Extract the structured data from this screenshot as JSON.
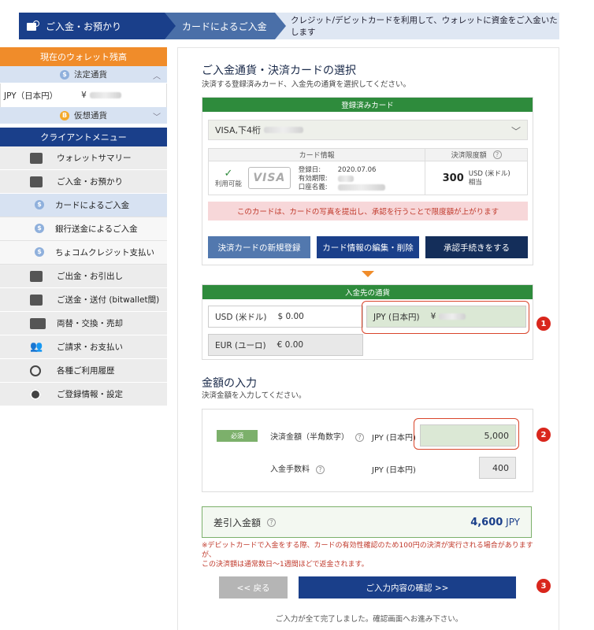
{
  "breadcrumb": {
    "step1": "ご入金・お預かり",
    "step2": "カードによるご入金",
    "description": "クレジット/デビットカードを利用して、ウォレットに資金をご入金いたします"
  },
  "sidebar": {
    "wallet_balance_title": "現在のウォレット残高",
    "fiat_label": "法定通貨",
    "balance_currency": "JPY（日本円）",
    "balance_symbol": "¥",
    "crypto_label": "仮想通貨",
    "menu_title": "クライアントメニュー",
    "items": [
      {
        "label": "ウォレットサマリー"
      },
      {
        "label": "ご入金・お預かり"
      },
      {
        "label": "カードによるご入金"
      },
      {
        "label": "銀行送金によるご入金"
      },
      {
        "label": "ちょコムクレジット支払い"
      },
      {
        "label": "ご出金・お引出し"
      },
      {
        "label": "ご送金・送付 (bitwallet間)"
      },
      {
        "label": "両替・交換・売却"
      },
      {
        "label": "ご請求・お支払い"
      },
      {
        "label": "各種ご利用履歴"
      },
      {
        "label": "ご登録情報・設定"
      }
    ]
  },
  "card_section": {
    "title": "ご入金通貨・決済カードの選択",
    "description": "決済する登録済みカード、入金先の通貨を選択してください。",
    "registered_header": "登録済みカード",
    "selected_card": "VISA,下4桁",
    "table_head_info": "カード情報",
    "table_head_limit": "決済限度額",
    "status": "利用可能",
    "brand": "VISA",
    "reg_date_label": "登録日:",
    "reg_date": "2020.07.06",
    "expiry_label": "有効期限:",
    "holder_label": "口座名義:",
    "limit_amount": "300",
    "limit_currency": "USD (米ドル)",
    "limit_suffix": "相当",
    "notice": "このカードは、カードの写真を提出し、承認を行うことで限度額が上がります",
    "btn_register": "決済カードの新規登録",
    "btn_edit": "カード情報の編集・削除",
    "btn_approve": "承認手続きをする"
  },
  "currency_section": {
    "header": "入金先の通貨",
    "usd_label": "USD (米ドル)",
    "usd_amount": "$ 0.00",
    "jpy_label": "JPY (日本円)",
    "jpy_symbol": "¥",
    "eur_label": "EUR (ユーロ)",
    "eur_amount": "€ 0.00"
  },
  "amount_section": {
    "title": "金額の入力",
    "description": "決済金額を入力してください。",
    "required_badge": "必須",
    "amount_label": "決済金額（半角数字）",
    "amount_currency": "JPY (日本円)",
    "amount_value": "5,000",
    "fee_label": "入金手数料",
    "fee_currency": "JPY (日本円)",
    "fee_value": "400",
    "net_label": "差引入金額",
    "net_value": "4,600",
    "net_unit": "JPY",
    "warning_line1": "※デビットカードで入金をする際、カードの有効性確認のため100円の決済が実行される場合がありますが、",
    "warning_line2": "この決済額は通常数日〜1週間ほどで返金されます。",
    "btn_back": "<< 戻る",
    "btn_confirm": "ご入力内容の確認 >>",
    "footer": "ご入力が全て完了しました。確認画面へお進み下さい。"
  },
  "annotations": [
    "1",
    "2",
    "3"
  ],
  "colors": {
    "navy": "#1a3f8a",
    "orange": "#f08c2a",
    "green": "#2e8b3c",
    "red_marker": "#d9261c"
  }
}
